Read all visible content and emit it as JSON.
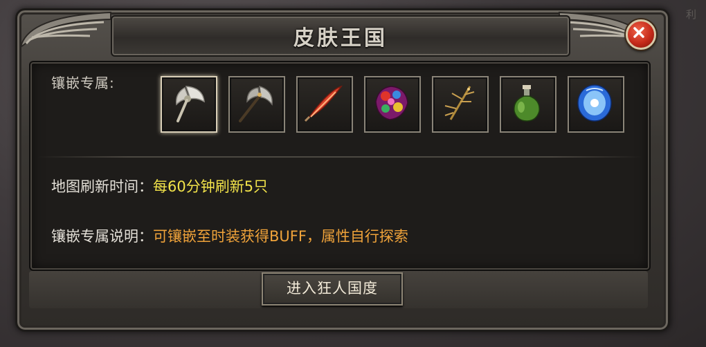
{
  "background": {
    "corner_text": "利"
  },
  "window": {
    "title": "皮肤王国",
    "close_icon": "close-x-icon"
  },
  "inlay": {
    "label": "镶嵌专属:",
    "items": [
      {
        "icon": "silver-axe-icon",
        "selected": true
      },
      {
        "icon": "battle-axe-icon",
        "selected": false
      },
      {
        "icon": "red-feather-icon",
        "selected": false
      },
      {
        "icon": "gem-cluster-icon",
        "selected": false
      },
      {
        "icon": "golden-twig-icon",
        "selected": false
      },
      {
        "icon": "green-potion-icon",
        "selected": false
      },
      {
        "icon": "blue-orb-icon",
        "selected": false
      }
    ]
  },
  "info": {
    "refresh_label": "地图刷新时间：",
    "refresh_value": "每60分钟刷新5只",
    "desc_label": "镶嵌专属说明：",
    "desc_value": "可镶嵌至时装获得BUFF，属性自行探索"
  },
  "enter_button": {
    "label": "进入狂人国度"
  },
  "colors": {
    "value_yellow": "#f2e34a",
    "value_orange": "#f0a33a",
    "close_red": "#c52a1a"
  }
}
